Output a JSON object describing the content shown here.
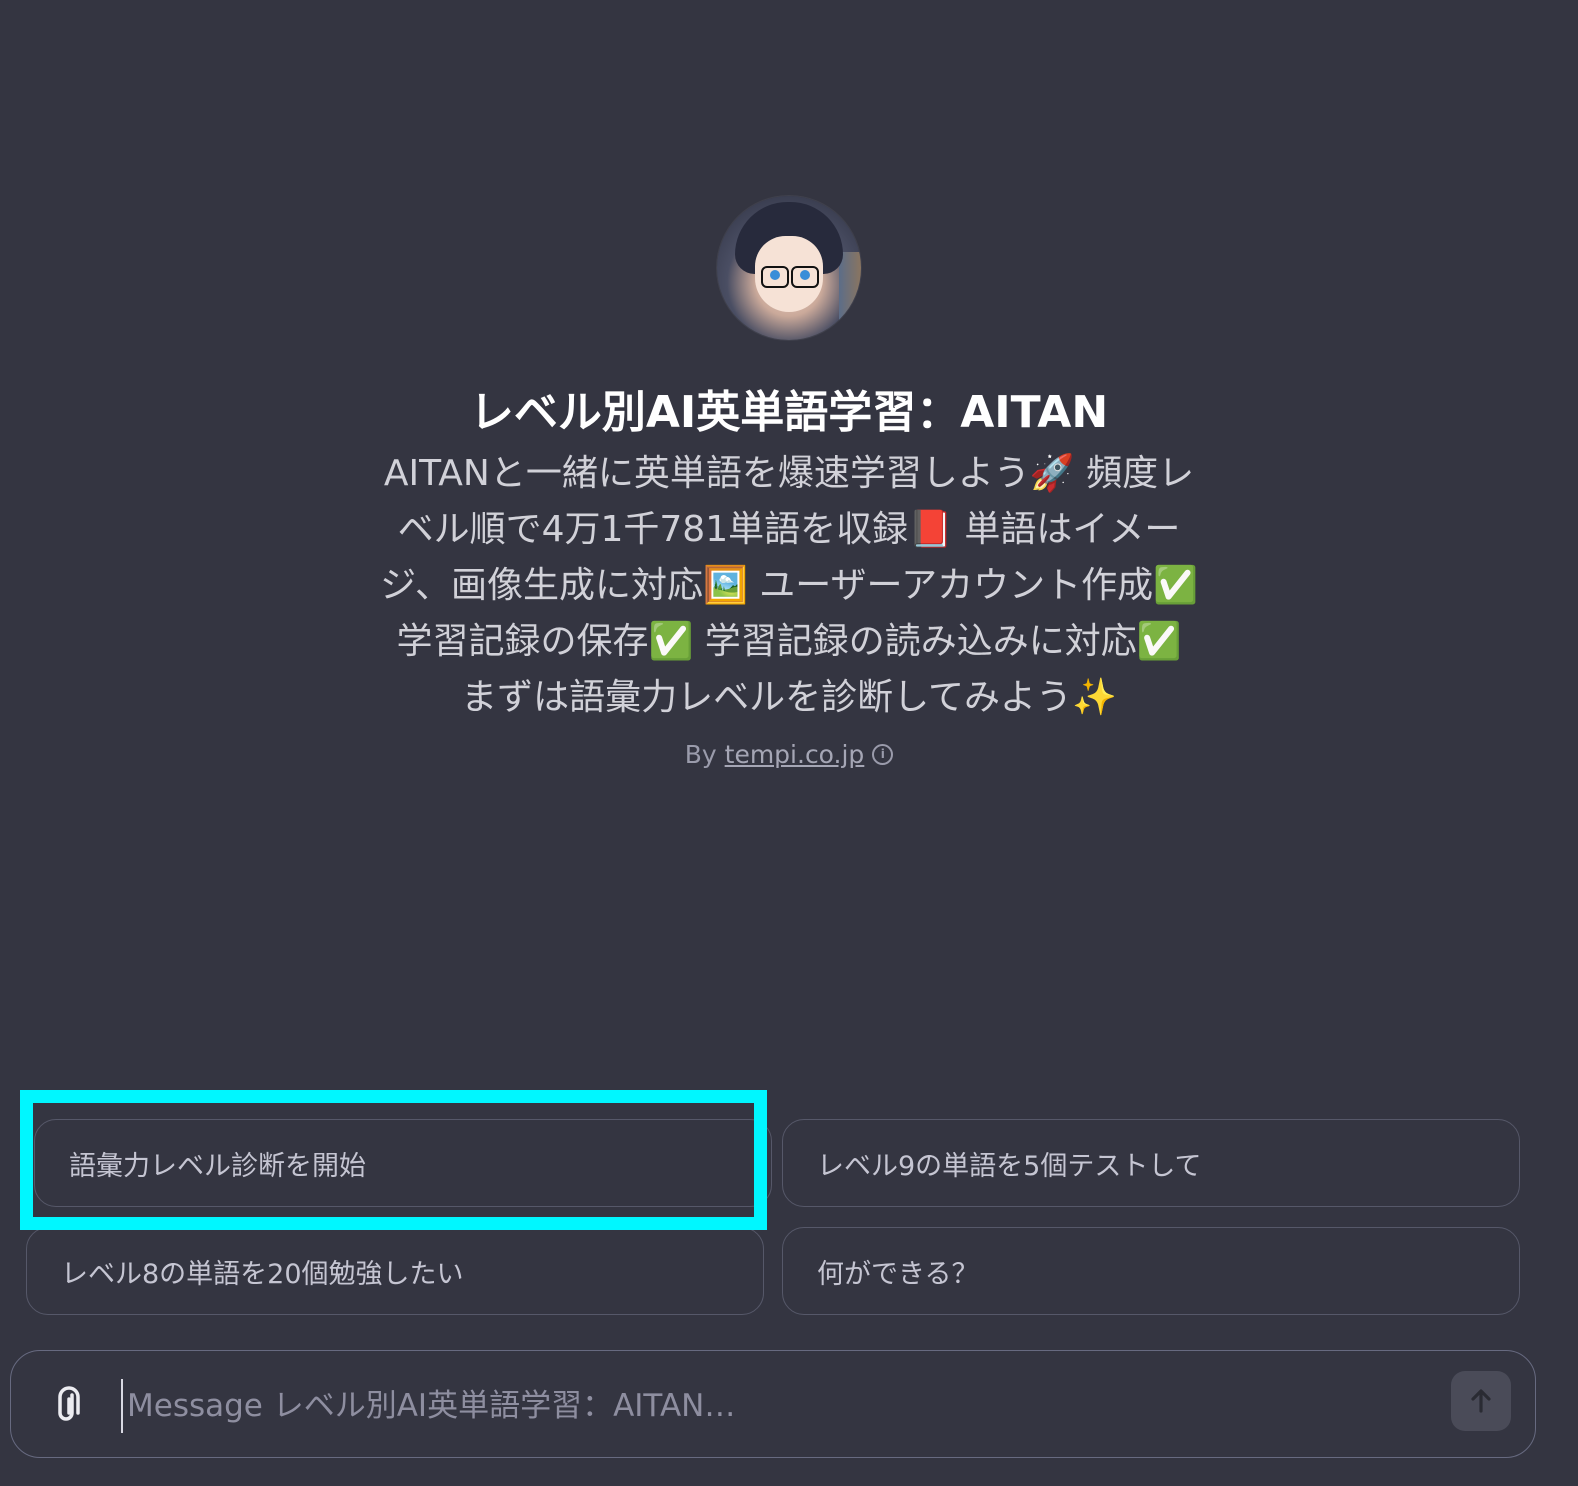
{
  "gpt": {
    "avatar_icon": "anime-girl-with-glasses-avatar",
    "title": "レベル別AI英単語学習：AITAN",
    "description": "AITANと一緒に英単語を爆速学習しよう🚀 頻度レ\nベル順で4万1千781単語を収録📕 単語はイメー\nジ、画像生成に対応🖼️ ユーザーアカウント作成✅\n学習記録の保存✅ 学習記録の読み込みに対応✅\nまずは語彙力レベルを診断してみよう✨",
    "by_prefix": "By",
    "author": "tempi.co.jp",
    "info_icon": "info-icon"
  },
  "suggestions": [
    "語彙力レベル診断を開始",
    "レベル9の単語を5個テストして",
    "レベル8の単語を20個勉強したい",
    "何ができる？"
  ],
  "highlight_color": "#00f7ff",
  "composer": {
    "placeholder": "Message レベル別AI英単語学習：AITAN…",
    "attach_icon": "paperclip-icon",
    "send_icon": "arrow-up-icon"
  }
}
